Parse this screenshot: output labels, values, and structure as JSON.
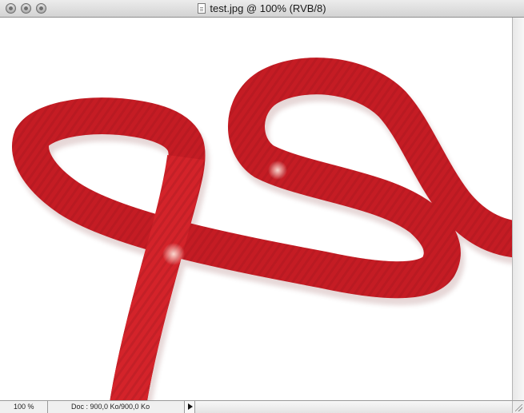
{
  "window": {
    "title": "test.jpg @ 100% (RVB/8)",
    "buttons": [
      "close",
      "minimize",
      "zoom"
    ]
  },
  "canvas": {
    "image_subject": "red-ribbon-icon",
    "ribbon_color": "#d42329",
    "background_color": "#ffffff"
  },
  "statusbar": {
    "zoom": "100 %",
    "doc_info": "Doc : 900,0 Ko/900,0 Ko"
  }
}
